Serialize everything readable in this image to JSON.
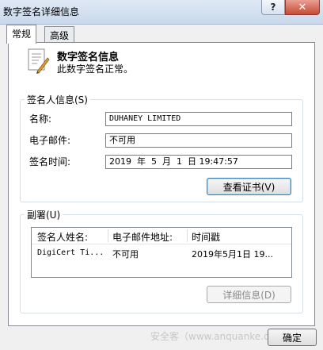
{
  "window": {
    "title": "数字签名详细信息",
    "help_label": "?",
    "close_label": "✕"
  },
  "tabs": [
    {
      "label": "常规",
      "active": true
    },
    {
      "label": "高级",
      "active": false
    }
  ],
  "header": {
    "title": "数字签名信息",
    "subtitle": "此数字签名正常。"
  },
  "signer": {
    "legend": "签名人信息(S)",
    "name_label": "名称:",
    "name_value": "DUHANEY LIMITED",
    "email_label": "电子邮件:",
    "email_value": "不可用",
    "time_label": "签名时间:",
    "time_value": "2019  年  5  月  1  日 19:47:57",
    "view_cert_label": "查看证书(V)"
  },
  "countersign": {
    "legend": "副署(U)",
    "columns": [
      "签名人姓名:",
      "电子邮件地址:",
      "时间戳"
    ],
    "rows": [
      {
        "name": "DigiCert Ti...",
        "email": "不可用",
        "timestamp": "2019年5月1日 19..."
      }
    ],
    "details_label": "详细信息(D)"
  },
  "footer": {
    "ok_label": "确定",
    "watermark": "安全客（www.anquanke.com）"
  }
}
